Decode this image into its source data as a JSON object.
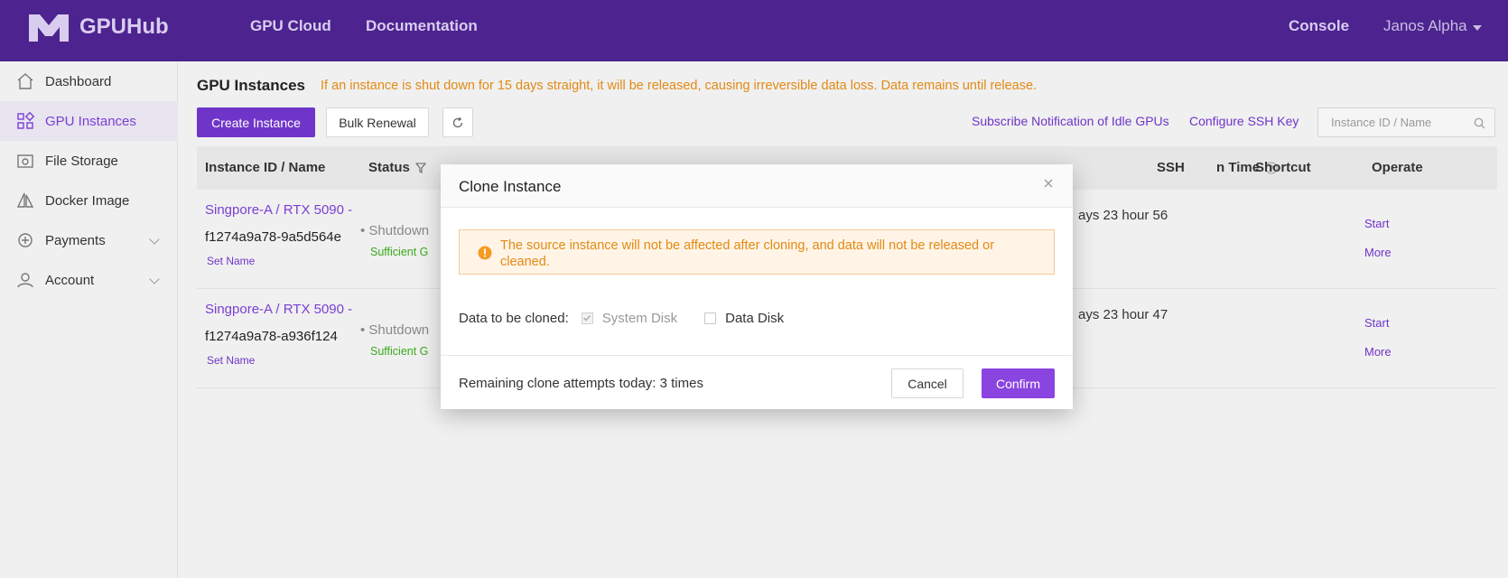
{
  "topbar": {
    "brand": "GPUHub",
    "nav": [
      "GPU Cloud",
      "Documentation"
    ],
    "console": "Console",
    "user": "Janos Alpha"
  },
  "sidebar": {
    "items": [
      {
        "label": "Dashboard",
        "icon": "home-icon"
      },
      {
        "label": "GPU Instances",
        "icon": "grid-icon",
        "active": true
      },
      {
        "label": "File Storage",
        "icon": "folder-icon"
      },
      {
        "label": "Docker Image",
        "icon": "sail-icon"
      },
      {
        "label": "Payments",
        "icon": "wallet-icon",
        "expandable": true
      },
      {
        "label": "Account",
        "icon": "user-icon",
        "expandable": true
      }
    ]
  },
  "main": {
    "title": "GPU Instances",
    "warning": "If an instance is shut down for 15 days straight, it will be released, causing irreversible data loss. Data remains until release.",
    "toolbar": {
      "create": "Create Instance",
      "bulk_renewal": "Bulk Renewal",
      "subscribe": "Subscribe Notification of Idle GPUs",
      "ssh_key": "Configure SSH Key",
      "search_placeholder": "Instance ID / Name"
    },
    "table": {
      "headers": {
        "id": "Instance ID / Name",
        "status": "Status",
        "time": "n Time",
        "ssh": "SSH",
        "shortcut": "Shortcut",
        "operate": "Operate"
      },
      "rows": [
        {
          "name": "Singpore-A / RTX 5090 -",
          "id": "f1274a9a78-9a5d564e",
          "set_name": "Set Name",
          "status": "• Shutdown",
          "sub": "Sufficient G",
          "time": "ays 23 hour 56",
          "start": "Start",
          "more": "More"
        },
        {
          "name": "Singpore-A / RTX 5090 -",
          "id": "f1274a9a78-a936f124",
          "set_name": "Set Name",
          "status": "• Shutdown",
          "sub": "Sufficient G",
          "time": "ays 23 hour 47",
          "start": "Start",
          "more": "More"
        }
      ]
    }
  },
  "modal": {
    "title": "Clone Instance",
    "alert": "The source instance will not be affected after cloning, and data will not be released or cleaned.",
    "clone_label": "Data to be cloned:",
    "system_disk": "System Disk",
    "data_disk": "Data Disk",
    "remaining": "Remaining clone attempts today: 3 times",
    "cancel": "Cancel",
    "confirm": "Confirm"
  },
  "colors": {
    "topbar": "#4c238f",
    "accent": "#6f35c8",
    "warning": "#e28a14",
    "success": "#3aa91c"
  }
}
